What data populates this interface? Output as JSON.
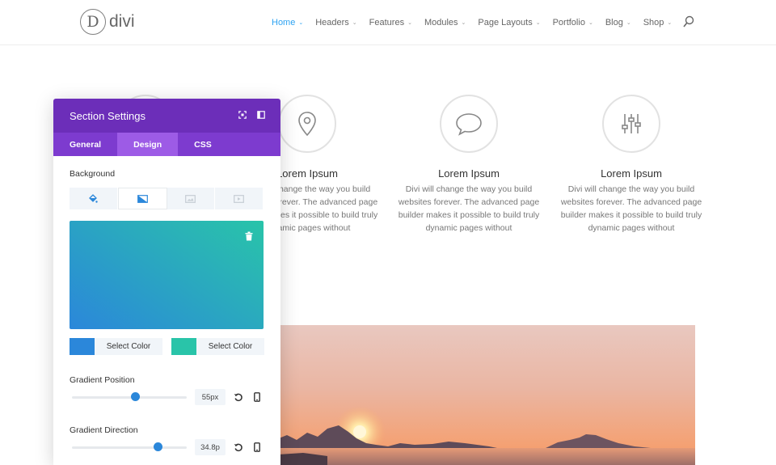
{
  "header": {
    "logo_mark": "D",
    "logo_text": "divi",
    "nav": [
      {
        "label": "Home",
        "active": true
      },
      {
        "label": "Headers"
      },
      {
        "label": "Features"
      },
      {
        "label": "Modules"
      },
      {
        "label": "Page Layouts"
      },
      {
        "label": "Portfolio"
      },
      {
        "label": "Blog"
      },
      {
        "label": "Shop"
      }
    ],
    "chevron": "⌄"
  },
  "features": [
    {
      "icon": "location-pin-icon",
      "title": "Lorem Ipsum",
      "text": "Divi will change the way you build websites forever. The advanced page builder makes it possible to build truly dynamic pages without"
    },
    {
      "icon": "chat-bubble-icon",
      "title": "Lorem Ipsum",
      "text": "Divi will change the way you build websites forever. The advanced page builder makes it possible to build truly dynamic pages without"
    },
    {
      "icon": "sliders-icon",
      "title": "Lorem Ipsum",
      "text": "Divi will change the way you build websites forever. The advanced page builder makes it possible to build truly dynamic pages without"
    }
  ],
  "panel": {
    "title": "Section Settings",
    "tabs": [
      {
        "label": "General"
      },
      {
        "label": "Design",
        "active": true
      },
      {
        "label": "CSS"
      }
    ],
    "background_label": "Background",
    "background_types": [
      "paint-bucket-icon",
      "gradient-icon",
      "image-icon",
      "video-icon"
    ],
    "gradient": {
      "color_start": "#2b87da",
      "color_end": "#29c4a9",
      "select_color_label_1": "Select Color",
      "select_color_label_2": "Select Color"
    },
    "gradient_position": {
      "label": "Gradient Position",
      "value": "55px",
      "slider_fraction": 0.55
    },
    "gradient_direction": {
      "label": "Gradient Direction",
      "value": "34.8p",
      "slider_fraction": 0.75
    }
  },
  "colors": {
    "accent": "#2ea3f2",
    "panel_header": "#6c2eb9",
    "panel_tabs": "#7d3bcf",
    "active_tab": "#9d5be6",
    "slider": "#2b87da"
  }
}
